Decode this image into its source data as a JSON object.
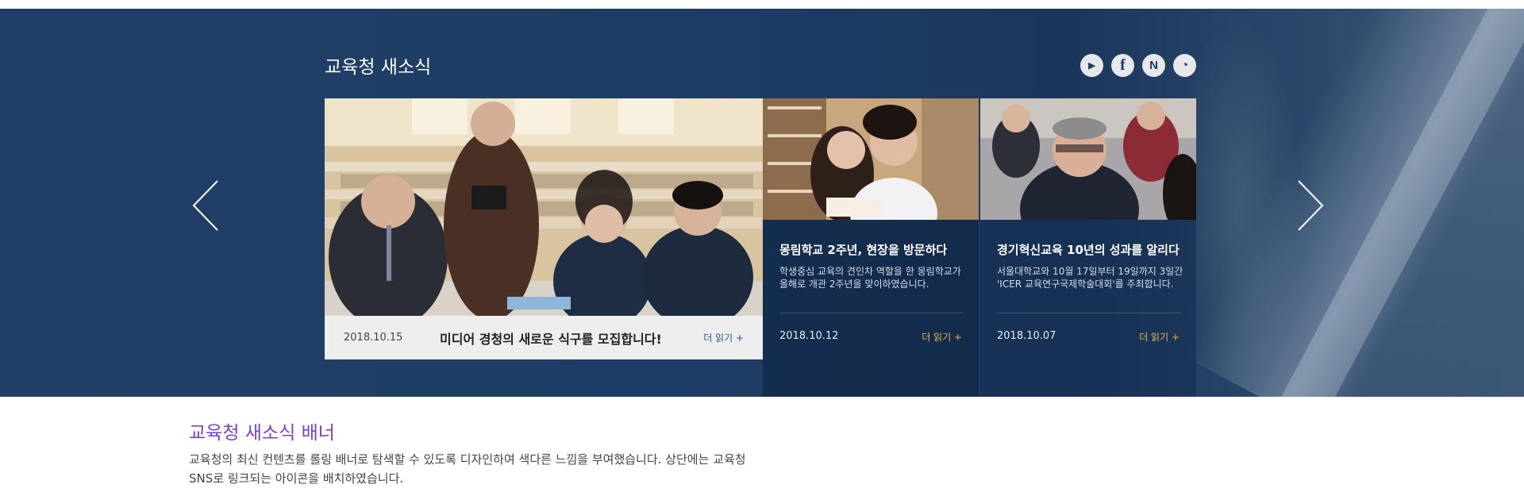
{
  "section": {
    "title": "교육청 새소식"
  },
  "sns": [
    {
      "name": "youtube",
      "glyph": "▶"
    },
    {
      "name": "facebook",
      "glyph": "f"
    },
    {
      "name": "naver",
      "glyph": "N"
    },
    {
      "name": "channel",
      "glyph": "◔"
    }
  ],
  "main_news": {
    "date": "2018.10.15",
    "headline": "미디어 경청의 새로운 식구를 모집합니다!",
    "more": "더 읽기 +"
  },
  "side_news": [
    {
      "title": "몽림학교 2주년, 현장을 방문하다",
      "desc": "학생중심 교육의 견인차 역할을 한 몽림학교가 올해로 개관 2주년을 맞이하였습니다.",
      "date": "2018.10.12",
      "more": "더 읽기 +"
    },
    {
      "title": "경기혁신교육 10년의 성과를 알리다",
      "desc": "서울대학교와 10월 17일부터 19일까지 3일간 'ICER 교육연구국제학술대회'를 주최합니다.",
      "date": "2018.10.07",
      "more": "더 읽기 +"
    }
  ],
  "banner": {
    "title": "교육청 새소식 배너",
    "desc": "교육청의 최신 컨텐츠를 롤링 배너로 탐색할 수 있도록 디자인하여 색다른 느낌을 부여했습니다. 상단에는 교육청 SNS로 링크되는 아이콘을 배치하였습니다."
  },
  "colors": {
    "hero_bg": "#1e3d66",
    "accent_gold": "#e8b64c",
    "link_blue": "#1e5aa8",
    "banner_title_purple": "#7b3fd6"
  }
}
